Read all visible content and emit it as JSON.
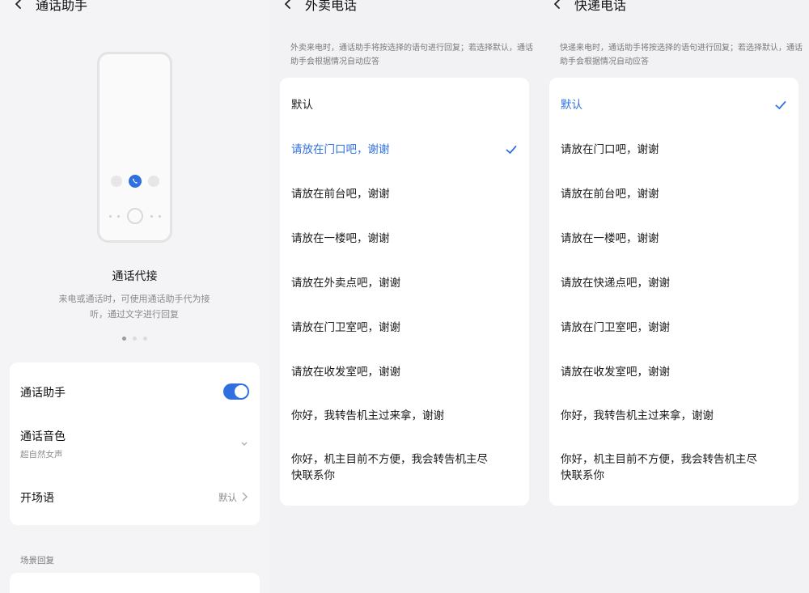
{
  "panel1": {
    "title": "通话助手",
    "hero_title": "通话代接",
    "hero_desc": "来电或通话时，可使用通话助手代为接听，通过文字进行回复",
    "settings": {
      "assistant_label": "通话助手",
      "assistant_on": true,
      "voice_label": "通话音色",
      "voice_value": "超自然女声",
      "opening_label": "开场语",
      "opening_value": "默认"
    },
    "section_label": "场景回复"
  },
  "panel2": {
    "title": "外卖电话",
    "desc": "外卖来电时，通话助手将按选择的语句进行回复；若选择默认，通话助手会根据情况自动应答",
    "selected_index": 1,
    "options": [
      "默认",
      "请放在门口吧，谢谢",
      "请放在前台吧，谢谢",
      "请放在一楼吧，谢谢",
      "请放在外卖点吧，谢谢",
      "请放在门卫室吧，谢谢",
      "请放在收发室吧，谢谢",
      "你好，我转告机主过来拿，谢谢",
      "你好，机主目前不方便，我会转告机主尽快联系你"
    ]
  },
  "panel3": {
    "title": "快递电话",
    "desc": "快递来电时，通话助手将按选择的语句进行回复；若选择默认，通话助手会根据情况自动应答",
    "selected_index": 0,
    "options": [
      "默认",
      "请放在门口吧，谢谢",
      "请放在前台吧，谢谢",
      "请放在一楼吧，谢谢",
      "请放在快递点吧，谢谢",
      "请放在门卫室吧，谢谢",
      "请放在收发室吧，谢谢",
      "你好，我转告机主过来拿，谢谢",
      "你好，机主目前不方便，我会转告机主尽快联系你"
    ]
  },
  "colors": {
    "accent": "#2f6fe0",
    "background": "#f2f2f4",
    "card": "#ffffff"
  }
}
